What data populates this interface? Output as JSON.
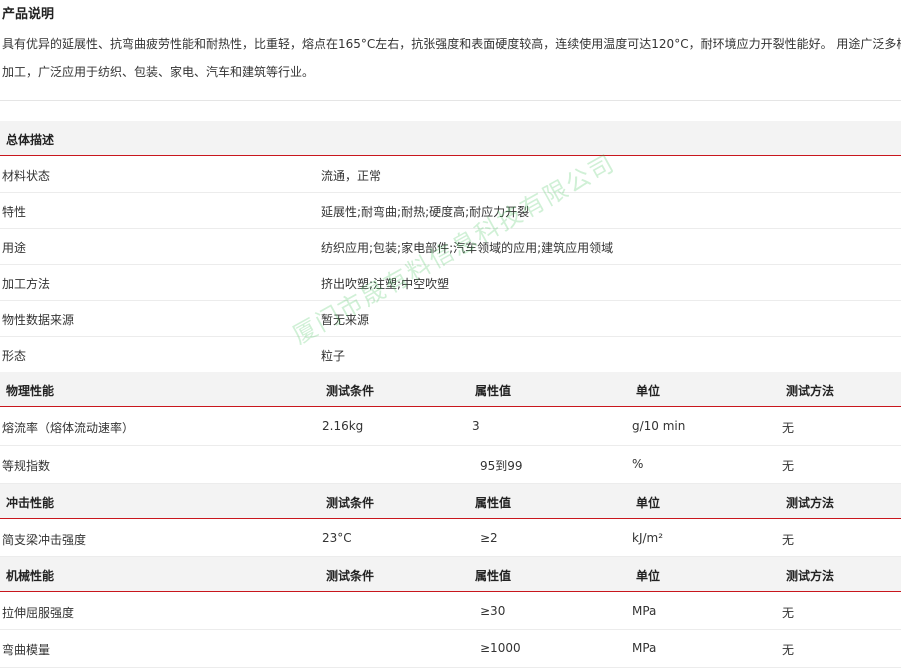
{
  "product": {
    "title": "产品说明",
    "desc_line1": "具有优异的延展性、抗弯曲疲劳性能和耐热性，比重轻，熔点在165°C左右，抗张强度和表面硬度较高，连续使用温度可达120°C，耐环境应力开裂性能好。 用途广泛多样，",
    "desc_line2": "加工，广泛应用于纺织、包装、家电、汽车和建筑等行业。"
  },
  "general": {
    "heading": "总体描述",
    "rows": [
      {
        "label": "材料状态",
        "value": "流通，正常"
      },
      {
        "label": "特性",
        "value": "延展性;耐弯曲;耐热;硬度高;耐应力开裂"
      },
      {
        "label": "用途",
        "value": "纺织应用;包装;家电部件;汽车领域的应用;建筑应用领域"
      },
      {
        "label": "加工方法",
        "value": "挤出吹塑;注塑;中空吹塑"
      },
      {
        "label": "物性数据来源",
        "value": "暂无来源"
      },
      {
        "label": "形态",
        "value": "粒子"
      }
    ]
  },
  "columns": {
    "condition": "测试条件",
    "value": "属性值",
    "unit": "单位",
    "method": "测试方法"
  },
  "physical": {
    "heading": "物理性能",
    "rows": [
      {
        "name": "熔流率（熔体流动速率）",
        "condition": "2.16kg",
        "value": "3",
        "unit": "g/10 min",
        "method": "无"
      },
      {
        "name": "等规指数",
        "condition": "",
        "value": "95到99",
        "unit": "%",
        "method": "无"
      }
    ]
  },
  "impact": {
    "heading": "冲击性能",
    "rows": [
      {
        "name": "简支梁冲击强度",
        "condition": "23°C",
        "value": "≥2",
        "unit": "kJ/m²",
        "method": "无"
      }
    ]
  },
  "mechanical": {
    "heading": "机械性能",
    "rows": [
      {
        "name": "拉伸屈服强度",
        "condition": "",
        "value": "≥30",
        "unit": "MPa",
        "method": "无"
      },
      {
        "name": "弯曲模量",
        "condition": "",
        "value": "≥1000",
        "unit": "MPa",
        "method": "无"
      }
    ]
  },
  "watermark": "厦门市晟有料信息科技有限公司"
}
